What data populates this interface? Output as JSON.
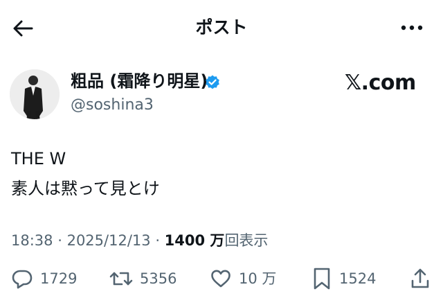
{
  "header": {
    "title": "ポスト",
    "back_icon": "arrow-left-icon",
    "more_icon": "more-dots-icon"
  },
  "author": {
    "name": "粗品 (霜降り明星)",
    "handle": "@soshina3",
    "verified_color": "#1d9bf0"
  },
  "watermark": "𝕏.com",
  "tweet": {
    "line1": "THE W",
    "line2": "素人は黙って見とけ"
  },
  "meta": {
    "time": "18:38",
    "date": "2025/12/13",
    "views_number": "1400 万",
    "views_label": "回表示"
  },
  "actions": {
    "reply": {
      "icon": "reply-icon",
      "count": "1729"
    },
    "repost": {
      "icon": "repost-icon",
      "count": "5356"
    },
    "like": {
      "icon": "heart-icon",
      "count": "10 万"
    },
    "bookmark": {
      "icon": "bookmark-icon",
      "count": "1524"
    },
    "share": {
      "icon": "share-icon"
    }
  },
  "colors": {
    "text": "#0f1419",
    "secondary": "#536471",
    "accent": "#1d9bf0"
  }
}
